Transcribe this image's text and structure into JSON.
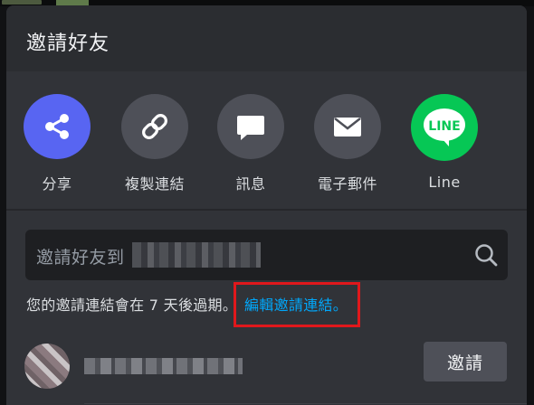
{
  "sheet": {
    "title": "邀請好友"
  },
  "share_options": [
    {
      "label": "分享",
      "icon": "share-icon",
      "color": "#5865f2"
    },
    {
      "label": "複製連結",
      "icon": "link-icon",
      "color": "#4e5058"
    },
    {
      "label": "訊息",
      "icon": "message-icon",
      "color": "#4e5058"
    },
    {
      "label": "電子郵件",
      "icon": "mail-icon",
      "color": "#4e5058"
    },
    {
      "label": "Line",
      "icon": "line-logo-icon",
      "color": "#06c755",
      "logo_text": "LINE"
    }
  ],
  "search": {
    "prefix": "邀請好友到"
  },
  "invite": {
    "expiry_text": "您的邀請連結會在 7 天後過期。",
    "edit_link": "編輯邀請連結。",
    "link_color": "#00a8fc",
    "highlight_color": "#e0181c"
  },
  "friend": {
    "button_label": "邀請"
  }
}
